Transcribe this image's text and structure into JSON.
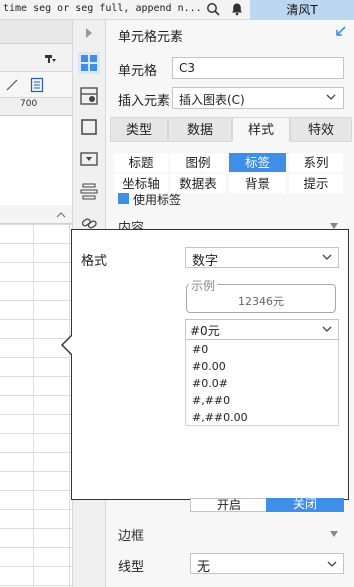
{
  "topbar": {
    "text": "time seg or seg full, append n...",
    "user": "清风T"
  },
  "sheet": {
    "ruler_label": "700"
  },
  "panel": {
    "title": "单元格元素",
    "cell_label": "单元格",
    "cell_value": "C3",
    "insert_label": "插入元素",
    "insert_value": "插入图表(C)",
    "main_tabs": [
      "类型",
      "数据",
      "样式",
      "特效"
    ],
    "sub_tabs_row1": [
      "标题",
      "图例",
      "标签",
      "系列"
    ],
    "sub_tabs_row2": [
      "坐标轴",
      "数据表",
      "背景",
      "提示"
    ],
    "use_label": "使用标签",
    "section_content": "内容",
    "switch_on": "开启",
    "switch_off": "关闭",
    "section_border": "边框",
    "line_type_label": "线型",
    "line_type_value": "无"
  },
  "popup": {
    "format_label": "格式",
    "format_value": "数字",
    "example_legend": "示例",
    "example_value": "12346元",
    "pattern_value": "#0元",
    "pattern_options": [
      "#0",
      "#0.00",
      "#0.0#",
      "#,##0",
      "#,##0.00"
    ]
  },
  "colors": {
    "accent": "#3f8ee8",
    "user_badge": "#bcd8f0"
  }
}
